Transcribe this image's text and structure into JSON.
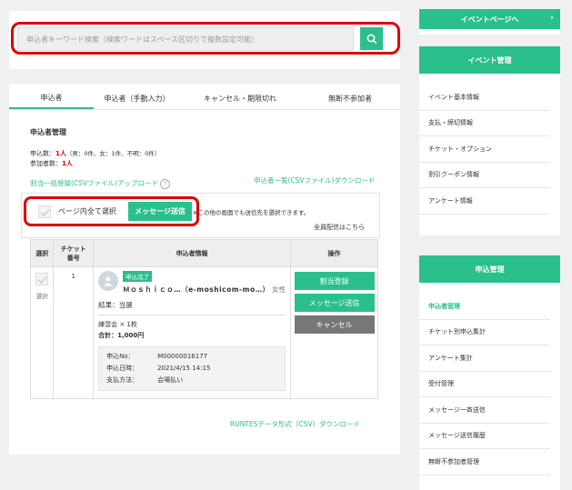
{
  "search": {
    "placeholder": "申込者キーワード検索（検索ワードはスペース区切りで複数設定可能）"
  },
  "tabs": [
    {
      "label": "申込者"
    },
    {
      "label": "申込者（手動入力）"
    },
    {
      "label": "キャンセル・期限切れ"
    },
    {
      "label": "無断不参加者"
    }
  ],
  "section_title": "申込者管理",
  "summary": {
    "applicants_prefix": "申込数：",
    "applicants_value": "1人",
    "applicants_detail": "（男：0件、女：1件、不明：0件）",
    "participants_prefix": "参加者数：",
    "participants_value": "1人"
  },
  "links": {
    "bulk_upload": "割当一括登録(CSVファイル)アップロード",
    "csv_download": "申込者一覧(CSVファイル)ダウンロード",
    "all_delivery": "全員配信はこちら",
    "runtes_download": "RUNTESデータ形式（CSV）ダウンロード"
  },
  "select_bar": {
    "select_all_label": "ページ内全て選択",
    "message_button": "メッセージ送信",
    "note": "※この他の画面でも送信先を選択できます。"
  },
  "table": {
    "headers": {
      "select": "選択",
      "ticket_line1": "チケット",
      "ticket_line2": "番号",
      "info": "申込者情報",
      "action": "操作"
    },
    "row": {
      "select_label": "選択",
      "ticket_no": "1",
      "status_badge": "申込完了",
      "name": "Ｍｏｓｈｉｃｏ…（e-moshicom-mo…）",
      "gender": "女性",
      "result": "結果：当選",
      "item": "練習会 × 1枚",
      "total": "合計：1,000円",
      "details": [
        {
          "label": "申込No：",
          "value": "M00000016177"
        },
        {
          "label": "申込日時：",
          "value": "2021/4/15 14:15"
        },
        {
          "label": "支払方法：",
          "value": "会場払い"
        }
      ],
      "actions": {
        "assign": "割当登録",
        "message": "メッセージ送信",
        "cancel": "キャンセル"
      }
    }
  },
  "sidebar": {
    "event_page_button": "イベントページへ",
    "event_mgmt": {
      "title": "イベント管理",
      "items": [
        "イベント基本情報",
        "支払・締切情報",
        "チケット・オプション",
        "割引クーポン情報",
        "アンケート情報"
      ]
    },
    "applicant_mgmt": {
      "title": "申込管理",
      "items": [
        "申込者管理",
        "チケット別申込集計",
        "アンケート集計",
        "受付管理",
        "メッセージ一斉送信",
        "メッセージ送信履歴",
        "無断不参加者管理"
      ]
    }
  },
  "colors": {
    "accent": "#2bbf8b",
    "highlight": "#d90000",
    "cancel": "#777777"
  }
}
